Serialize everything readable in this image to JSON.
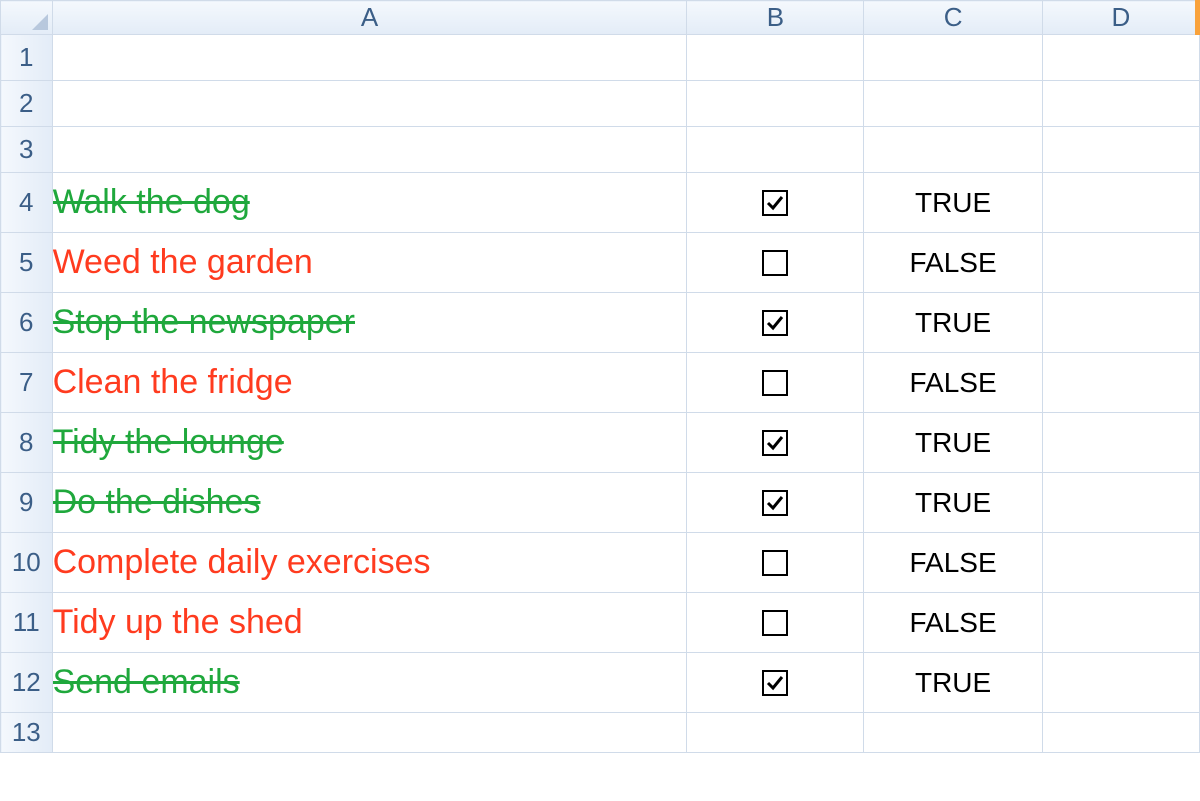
{
  "columns": [
    "A",
    "B",
    "C",
    "D"
  ],
  "row_numbers": [
    1,
    2,
    3,
    4,
    5,
    6,
    7,
    8,
    9,
    10,
    11,
    12,
    13
  ],
  "tasks": [
    {
      "text": "Walk the dog",
      "checked": true,
      "value": "TRUE"
    },
    {
      "text": "Weed the garden",
      "checked": false,
      "value": "FALSE"
    },
    {
      "text": "Stop the newspaper",
      "checked": true,
      "value": "TRUE"
    },
    {
      "text": "Clean the fridge",
      "checked": false,
      "value": "FALSE"
    },
    {
      "text": "Tidy the lounge",
      "checked": true,
      "value": "TRUE"
    },
    {
      "text": "Do the dishes",
      "checked": true,
      "value": "TRUE"
    },
    {
      "text": "Complete daily exercises",
      "checked": false,
      "value": "FALSE"
    },
    {
      "text": "Tidy up the shed",
      "checked": false,
      "value": "FALSE"
    },
    {
      "text": "Send emails",
      "checked": true,
      "value": "TRUE"
    }
  ],
  "colors": {
    "done": "#1fa83c",
    "undone": "#ff3b1f",
    "grid": "#d0dbe9",
    "header_text": "#3b5e87"
  }
}
